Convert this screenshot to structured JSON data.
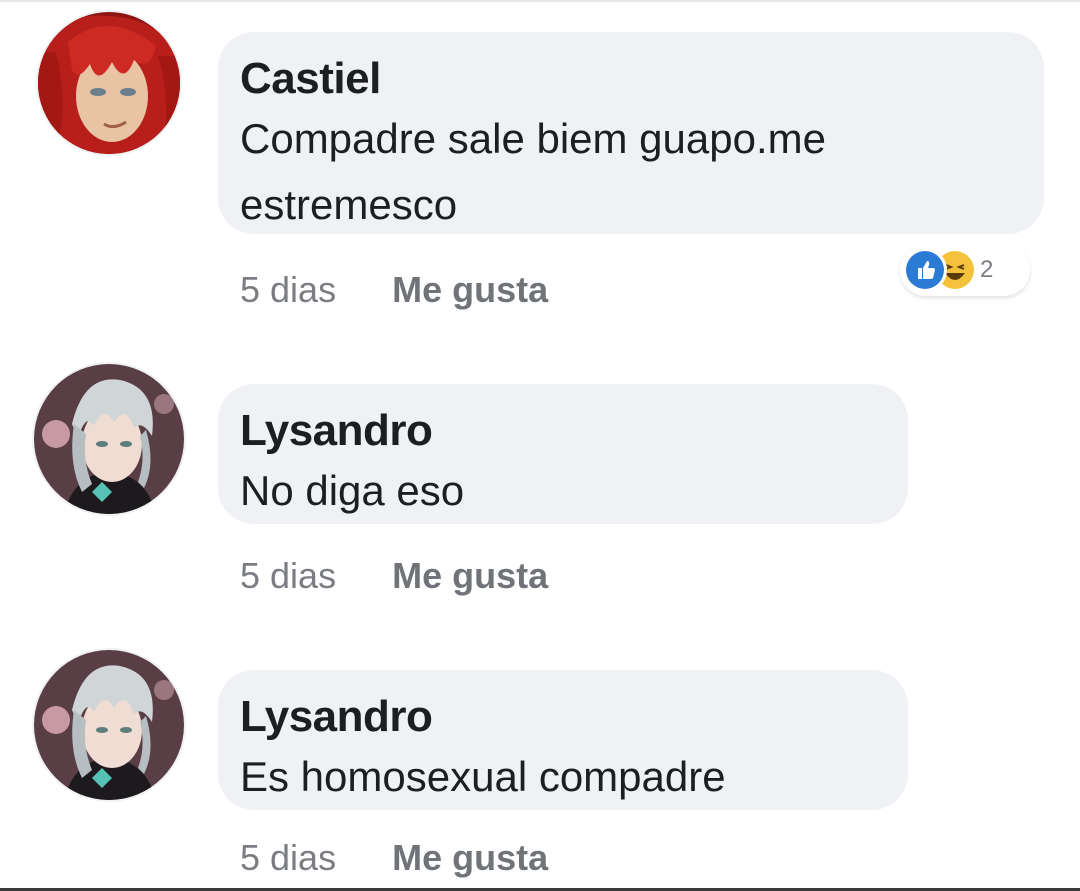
{
  "comments": [
    {
      "author": "Castiel",
      "text": "Compadre sale biem guapo.me estremesco",
      "time": "5 dias",
      "like_label": "Me gusta",
      "reaction_count": "2",
      "reactions": [
        "like-icon",
        "haha-icon"
      ]
    },
    {
      "author": "Lysandro",
      "text": "No diga eso",
      "time": "5 dias",
      "like_label": "Me gusta"
    },
    {
      "author": "Lysandro",
      "text": "Es homosexual compadre",
      "time": "5 dias",
      "like_label": "Me gusta"
    }
  ],
  "colors": {
    "bubble": "#f0f1f4",
    "like_reaction": "#2b7ad4",
    "haha_reaction": "#f5c33b",
    "castiel_hair": "#c0231f",
    "lysandro_hair": "#c9d0d2"
  }
}
